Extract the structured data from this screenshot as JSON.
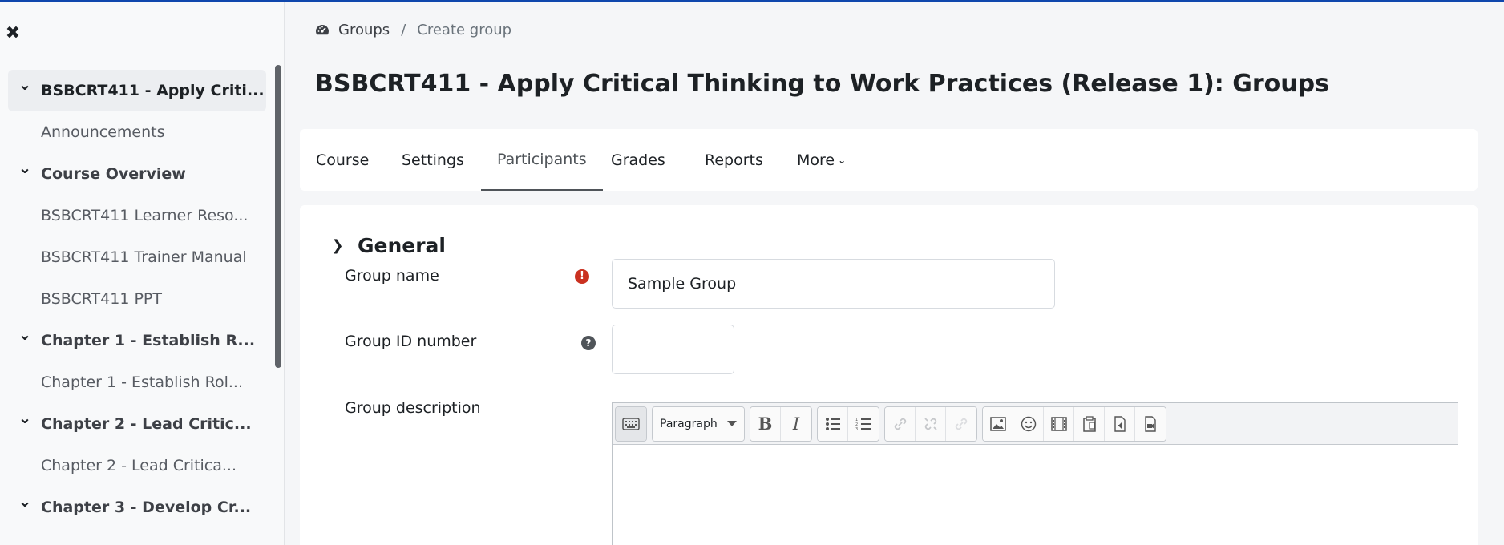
{
  "colors": {
    "accent_bar": "#0f47ad",
    "required": "#ca3120"
  },
  "sidebar": {
    "close_icon": "close-icon",
    "items": [
      {
        "label": "BSBCRT411 - Apply Criti...",
        "type": "section",
        "expanded": true,
        "active": true
      },
      {
        "label": "Announcements",
        "type": "sub"
      },
      {
        "label": "Course Overview",
        "type": "section",
        "expanded": true
      },
      {
        "label": "BSBCRT411 Learner Reso...",
        "type": "sub"
      },
      {
        "label": "BSBCRT411 Trainer Manual",
        "type": "sub"
      },
      {
        "label": "BSBCRT411 PPT",
        "type": "sub"
      },
      {
        "label": "Chapter 1 - Establish R...",
        "type": "section",
        "expanded": true
      },
      {
        "label": "Chapter 1 - Establish Rol...",
        "type": "sub"
      },
      {
        "label": "Chapter 2 - Lead Critic...",
        "type": "section",
        "expanded": true
      },
      {
        "label": "Chapter 2 - Lead Critica...",
        "type": "sub"
      },
      {
        "label": "Chapter 3 - Develop Cr...",
        "type": "section",
        "expanded": true
      }
    ]
  },
  "breadcrumb": {
    "icon": "gauge-icon",
    "items": [
      "Groups",
      "Create group"
    ]
  },
  "page_title": "BSBCRT411 - Apply Critical Thinking to Work Practices (Release 1): Groups",
  "tabs": [
    {
      "label": "Course"
    },
    {
      "label": "Settings"
    },
    {
      "label": "Participants",
      "active": true
    },
    {
      "label": "Grades"
    },
    {
      "label": "Reports"
    },
    {
      "label": "More",
      "caret": "chevron-down-icon"
    }
  ],
  "form": {
    "section_title": "General",
    "group_name": {
      "label": "Group name",
      "value": "Sample Group",
      "required": true
    },
    "group_id": {
      "label": "Group ID number",
      "value": "",
      "help": true
    },
    "group_description": {
      "label": "Group description",
      "format_select": "Paragraph",
      "toolbar_icons": [
        "keyboard-icon",
        "bold-icon",
        "italic-icon",
        "bullet-list-icon",
        "numbered-list-icon",
        "link-icon",
        "unlink-icon",
        "anchor-icon",
        "image-icon",
        "emoji-icon",
        "media-icon",
        "manage-files-icon",
        "record-audio-icon",
        "record-video-icon"
      ]
    }
  }
}
